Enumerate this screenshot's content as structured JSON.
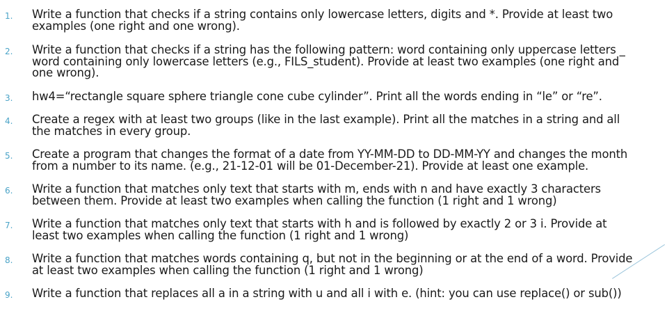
{
  "exercises": [
    {
      "number": "1.",
      "text": "Write a function that checks if a string contains only lowercase letters, digits and *. Provide at least two\nexamples (one right and one wrong)."
    },
    {
      "number": "2.",
      "text": "Write a function that checks if a string has the following pattern: word containing only uppercase letters _\nword containing only lowercase letters (e.g., FILS_student). Provide at least two examples (one right and\none wrong)."
    },
    {
      "number": "3.",
      "text": "hw4=“rectangle square sphere triangle cone cube cylinder”. Print all the words ending in “le” or “re”."
    },
    {
      "number": "4.",
      "text": "Create a regex with at least two groups (like in the last example). Print all the matches in a string and all\nthe matches in every group."
    },
    {
      "number": "5.",
      "text": "Create a program that changes the format of a date from YY-MM-DD to DD-MM-YY and changes the month\nfrom a number to its name. (e.g., 21-12-01 will be 01-December-21). Provide at least one example."
    },
    {
      "number": "6.",
      "text": "Write a function that matches only text that starts with m, ends with n and have exactly 3 characters\nbetween them. Provide at least two examples when calling the function (1 right and 1 wrong)"
    },
    {
      "number": "7.",
      "text": "Write a function that matches only text that starts with h and is followed by exactly 2 or 3 i. Provide at\nleast two examples when calling the function (1 right and 1 wrong)"
    },
    {
      "number": "8.",
      "text": "Write a function that matches words containing q, but not in the beginning or at the end of a word. Provide\nat least two examples when calling the function (1 right and 1 wrong)"
    },
    {
      "number": "9.",
      "text": "Write a function that replaces all a in a string with u and all i with e. (hint: you can use replace() or sub())"
    }
  ]
}
